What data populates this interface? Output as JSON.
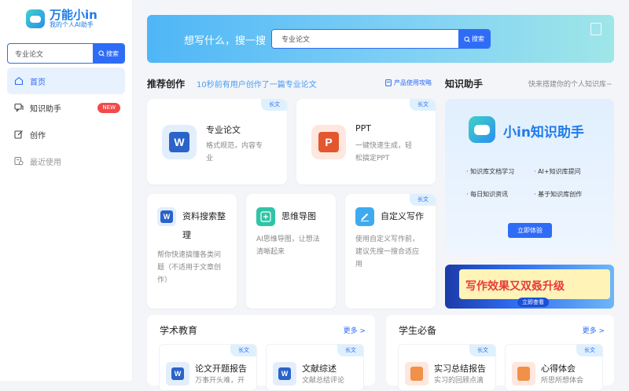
{
  "sidebar": {
    "logo_title": "万能小in",
    "logo_subtitle": "我的个人AI助手",
    "search": {
      "value": "专业论文",
      "button": "搜索"
    },
    "items": [
      {
        "label": "首页"
      },
      {
        "label": "知识助手",
        "badge": "NEW"
      },
      {
        "label": "创作"
      },
      {
        "label": "最近使用"
      }
    ]
  },
  "banner": {
    "prompt": "想写什么，搜一搜",
    "search_value": "专业论文",
    "search_button": "搜索"
  },
  "recommend": {
    "title": "推荐创作",
    "subtitle": "10秒前有用户创作了一篇专业论文",
    "guide_link": "产品使用攻略",
    "cards": [
      {
        "tag": "长文",
        "title": "专业论文",
        "desc_line1": "格式规范，内容专",
        "desc_line2": "业"
      },
      {
        "tag": "长文",
        "title": "PPT",
        "desc_line1": "一键快速生成，轻",
        "desc_line2": "松搞定PPT"
      },
      {
        "title_line1": "资料搜索整",
        "title_line2": "理",
        "desc_line1": "帮你快速搞懂各类问",
        "desc_line2": "题（不适用于文章创",
        "desc_line3": "作）"
      },
      {
        "title": "思维导图",
        "desc_line1": "AI思维导图，让想法",
        "desc_line2": "清晰起来"
      },
      {
        "tag": "长文",
        "title": "自定义写作",
        "desc_line1": "使用自定义写作前，",
        "desc_line2": "建议先搜一搜合适应",
        "desc_line3": "用"
      }
    ]
  },
  "knowledge": {
    "title": "知识助手",
    "subtitle": "快来搭建你的个人知识库~",
    "panel_title": "小in知识助手",
    "features": [
      "· 知识库文档学习",
      "· AI+知识库提问",
      "· 每日知识资讯",
      "· 基于知识库创作"
    ],
    "cta": "立即体验"
  },
  "promo": {
    "text": "写作效果又双叒升级",
    "button": "立即查看"
  },
  "academic": {
    "title": "学术教育",
    "more": "更多 >",
    "cards": [
      {
        "tag": "长文",
        "title": "论文开题报告",
        "desc": "万事开头难，开"
      },
      {
        "tag": "长文",
        "title": "文献综述",
        "desc": "文献总结评论"
      }
    ]
  },
  "student": {
    "title": "学生必备",
    "more": "更多 >",
    "cards": [
      {
        "tag": "长文",
        "title": "实习总结报告",
        "desc": "实习的回顾点滴"
      },
      {
        "tag": "长文",
        "title": "心得体会",
        "desc": "所思所想体会"
      }
    ]
  },
  "colors": {
    "accent": "#2f6cf6",
    "badge": "#f24a4a",
    "banner_start": "#4fb6f6",
    "banner_end": "#9fe6e8"
  }
}
